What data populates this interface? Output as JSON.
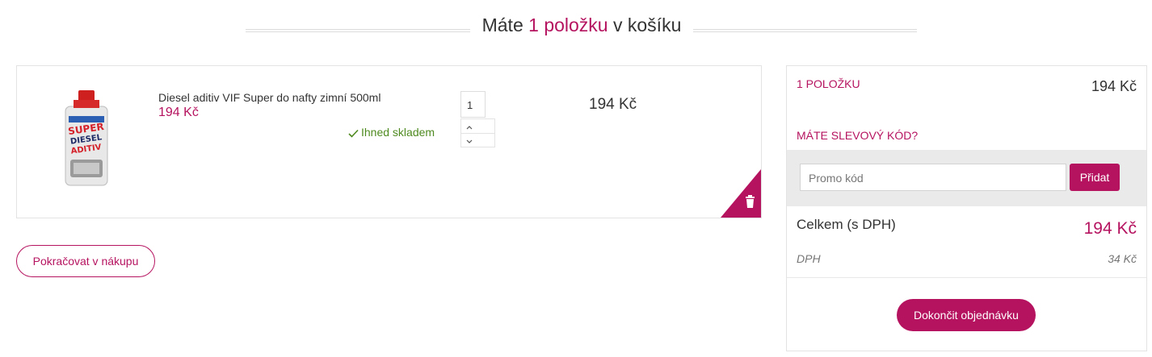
{
  "header": {
    "title_prefix": "Máte",
    "title_count": "1 položku",
    "title_suffix": "v košíku"
  },
  "cart": {
    "items": [
      {
        "image_icon": "diesel-additive-bottle-icon",
        "name": "Diesel aditiv VIF Super do nafty zimní 500ml",
        "unit_price": "194 Kč",
        "stock": "Ihned skladem",
        "quantity": "1",
        "row_price": "194 Kč"
      }
    ],
    "continue_label": "Pokračovat v nákupu"
  },
  "summary": {
    "count_label": "1 položku",
    "count_price": "194 Kč",
    "discount_label": "Máte slevový kód?",
    "promo_placeholder": "Promo kód",
    "promo_button": "Přidat",
    "total_label": "Celkem (s DPH)",
    "total_price": "194 Kč",
    "vat_label": "DPH",
    "vat_price": "34 Kč",
    "checkout_label": "Dokončit objednávku"
  },
  "colors": {
    "accent": "#b5135f",
    "stock_green": "#4e8a1f",
    "band_gray": "#eaeaea"
  }
}
